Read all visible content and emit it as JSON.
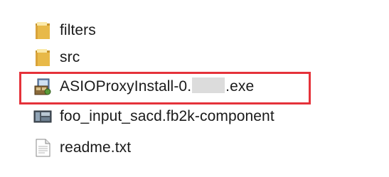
{
  "files": [
    {
      "name": "filters",
      "icon": "folder-icon"
    },
    {
      "name": "src",
      "icon": "folder-icon"
    },
    {
      "name_prefix": "ASIOProxyInstall-0.",
      "name_suffix": ".exe",
      "icon": "installer-icon"
    },
    {
      "name": "foo_input_sacd.fb2k-component",
      "icon": "component-file-icon"
    },
    {
      "name": "readme.txt",
      "icon": "text-file-icon"
    }
  ],
  "colors": {
    "highlight": "#e5323a",
    "folder": "#e8b948",
    "redaction": "#dcdcdc"
  }
}
